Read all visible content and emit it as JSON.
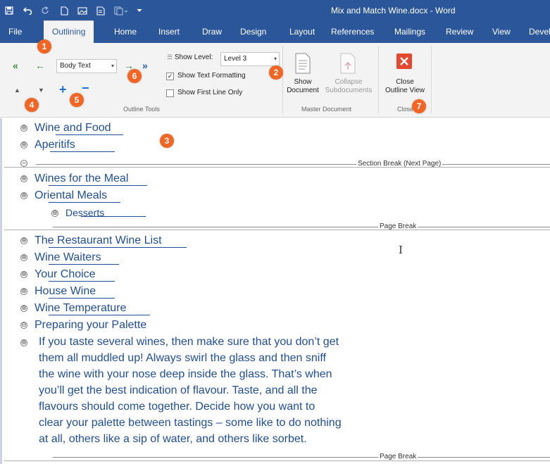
{
  "window": {
    "title": "Mix and Match Wine.docx  -  Word",
    "qat": [
      "save-icon",
      "undo-icon",
      "redo-icon",
      "new-document-icon",
      "picture-icon",
      "print-preview-icon",
      "copy-format-icon",
      "customize-icon"
    ]
  },
  "tabs": [
    {
      "label": "File"
    },
    {
      "label": "Outlining"
    },
    {
      "label": "Home"
    },
    {
      "label": "Insert"
    },
    {
      "label": "Draw"
    },
    {
      "label": "Design"
    },
    {
      "label": "Layout"
    },
    {
      "label": "References"
    },
    {
      "label": "Mailings"
    },
    {
      "label": "Review"
    },
    {
      "label": "View"
    },
    {
      "label": "Devel"
    }
  ],
  "outline_tools": {
    "level_value": "Body Text",
    "show_level_label": "Show Level:",
    "show_level_value": "Level 3",
    "show_text_formatting": "Show Text Formatting",
    "show_text_formatting_checked": true,
    "show_first_line_only": "Show First Line Only",
    "show_first_line_only_checked": false,
    "group_label": "Outline Tools"
  },
  "master_document": {
    "show_document_line1": "Show",
    "show_document_line2": "Document",
    "collapse_line1": "Collapse",
    "collapse_line2": "Subdocuments",
    "group_label": "Master Document"
  },
  "close": {
    "line1": "Close",
    "line2": "Outline View",
    "group_label": "Close"
  },
  "badges": [
    "1",
    "2",
    "3",
    "4",
    "5",
    "6",
    "7"
  ],
  "outline": {
    "items_top": [
      {
        "text": "Wine and Food",
        "symbol": "⊕"
      },
      {
        "text": "Aperitifs",
        "symbol": "⊕"
      }
    ],
    "section_break": "Section Break (Next Page)",
    "items_mid": [
      {
        "text": "Wines for the Meal",
        "symbol": "⊕"
      },
      {
        "text": "Oriental Meals",
        "symbol": "⊕"
      },
      {
        "text": "Desserts",
        "symbol": "⊕"
      }
    ],
    "page_break": "Page Break",
    "items_bottom": [
      {
        "text": "The Restaurant Wine List",
        "symbol": "⊕"
      },
      {
        "text": "Wine Waiters",
        "symbol": "⊕"
      },
      {
        "text": "Your Choice",
        "symbol": "⊕"
      },
      {
        "text": "House Wine",
        "symbol": "⊕"
      },
      {
        "text": "Wine Temperature",
        "symbol": "⊕"
      },
      {
        "text": "Preparing your Palette",
        "symbol": "⊖"
      }
    ],
    "body_symbol": "⊕",
    "body_lines": [
      "If you taste several wines, then make sure that you don’t get",
      "them all muddled up!  Always swirl the glass and then sniff",
      "the wine with your nose deep inside the glass.  That’s when",
      "you’ll get the best indication of flavour.  Taste, and all the",
      "flavours should come together.  Decide how you want to",
      "clear your palette between tastings – some like to do nothing",
      "at all, others like a sip of water, and others like sorbet."
    ],
    "page_break_2": "Page Break"
  },
  "colors": {
    "accent": "#2b579a",
    "badge": "#f26522",
    "outline_text": "#1f4e9c",
    "close_button": "#e2492f"
  }
}
